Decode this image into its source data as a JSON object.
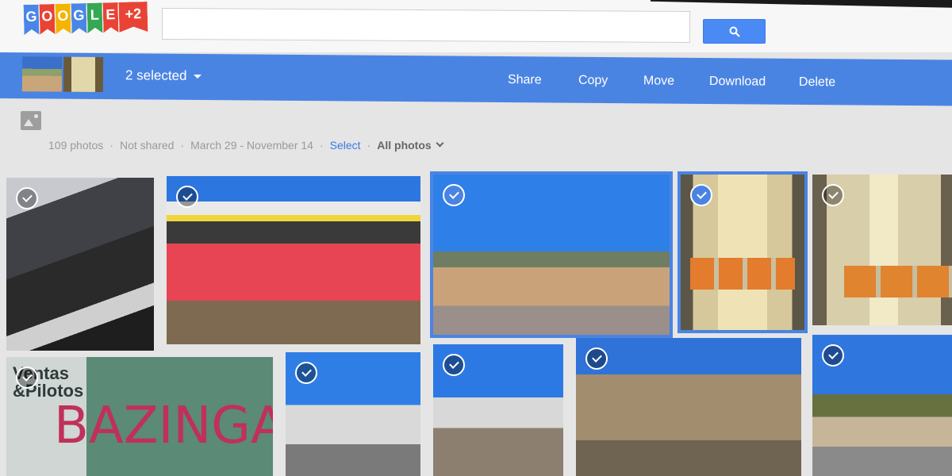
{
  "logo": {
    "letters": [
      "G",
      "O",
      "O",
      "G",
      "L",
      "E",
      "+2"
    ],
    "colors": [
      "#4a86e8",
      "#e94335",
      "#f5b400",
      "#4a86e8",
      "#34a853",
      "#e94335",
      "#e94335"
    ]
  },
  "search": {
    "value": "",
    "placeholder": ""
  },
  "selection": {
    "count_label": "2 selected",
    "actions": [
      "Share",
      "Copy",
      "Move",
      "Download",
      "Delete"
    ]
  },
  "album_info": {
    "count": "109 photos",
    "sharing": "Not shared",
    "date_range": "March 29 - November 14",
    "select_link": "Select",
    "filter": "All photos"
  },
  "photo_text": {
    "sign": "Ventas\n&Pilotos",
    "graffiti": "BAZINGA!"
  },
  "colors": {
    "accent": "#4a84e3",
    "search_button": "#4a8af4"
  },
  "icons": [
    "search-icon",
    "dropdown-caret-icon",
    "album-photo-icon",
    "chevron-down-icon",
    "check-icon"
  ]
}
